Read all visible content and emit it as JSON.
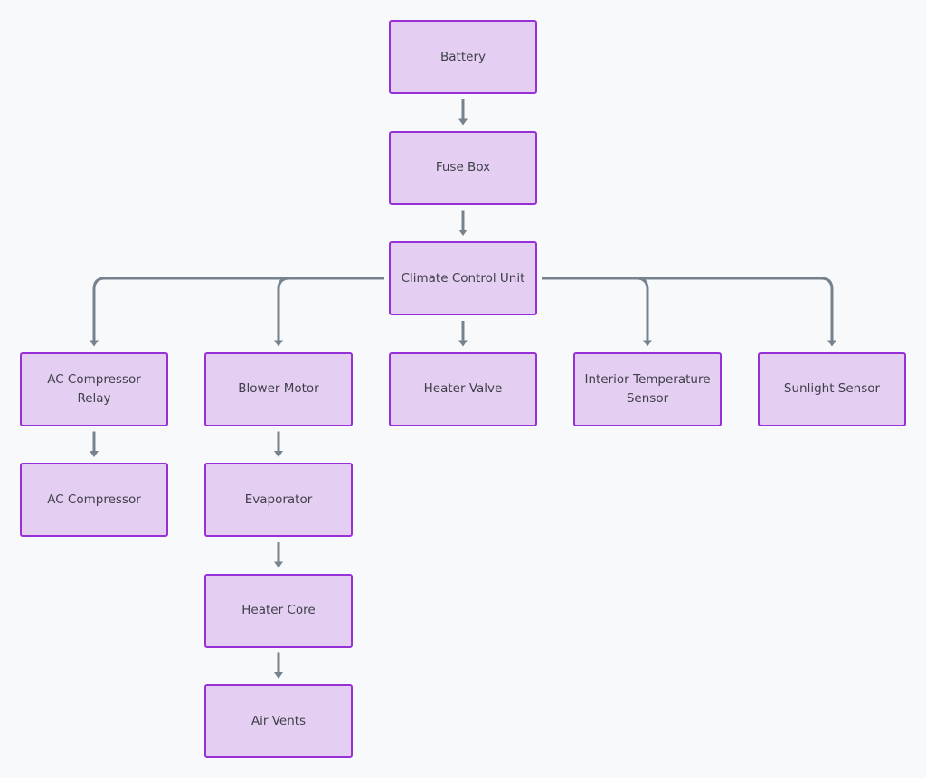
{
  "colors": {
    "background": "#f8f9fa",
    "node_fill": "#e4cff3",
    "node_border": "#9730d6",
    "edge": "#76838f",
    "text": "#3f3f4a"
  },
  "nodes": [
    {
      "id": "battery",
      "label": "Battery"
    },
    {
      "id": "fuse",
      "label": "Fuse Box"
    },
    {
      "id": "ccu",
      "label": "Climate Control Unit"
    },
    {
      "id": "acrelay",
      "label": "AC Compressor Relay"
    },
    {
      "id": "blower",
      "label": "Blower Motor"
    },
    {
      "id": "heatervalve",
      "label": "Heater Valve"
    },
    {
      "id": "intsensor",
      "label": "Interior Temperature Sensor"
    },
    {
      "id": "sunsensor",
      "label": "Sunlight Sensor"
    },
    {
      "id": "accomp",
      "label": "AC Compressor"
    },
    {
      "id": "evap",
      "label": "Evaporator"
    },
    {
      "id": "heatercore",
      "label": "Heater Core"
    },
    {
      "id": "vents",
      "label": "Air Vents"
    }
  ],
  "edges": [
    [
      "battery",
      "fuse"
    ],
    [
      "fuse",
      "ccu"
    ],
    [
      "ccu",
      "acrelay"
    ],
    [
      "ccu",
      "blower"
    ],
    [
      "ccu",
      "heatervalve"
    ],
    [
      "ccu",
      "intsensor"
    ],
    [
      "ccu",
      "sunsensor"
    ],
    [
      "acrelay",
      "accomp"
    ],
    [
      "blower",
      "evap"
    ],
    [
      "evap",
      "heatercore"
    ],
    [
      "heatercore",
      "vents"
    ]
  ]
}
